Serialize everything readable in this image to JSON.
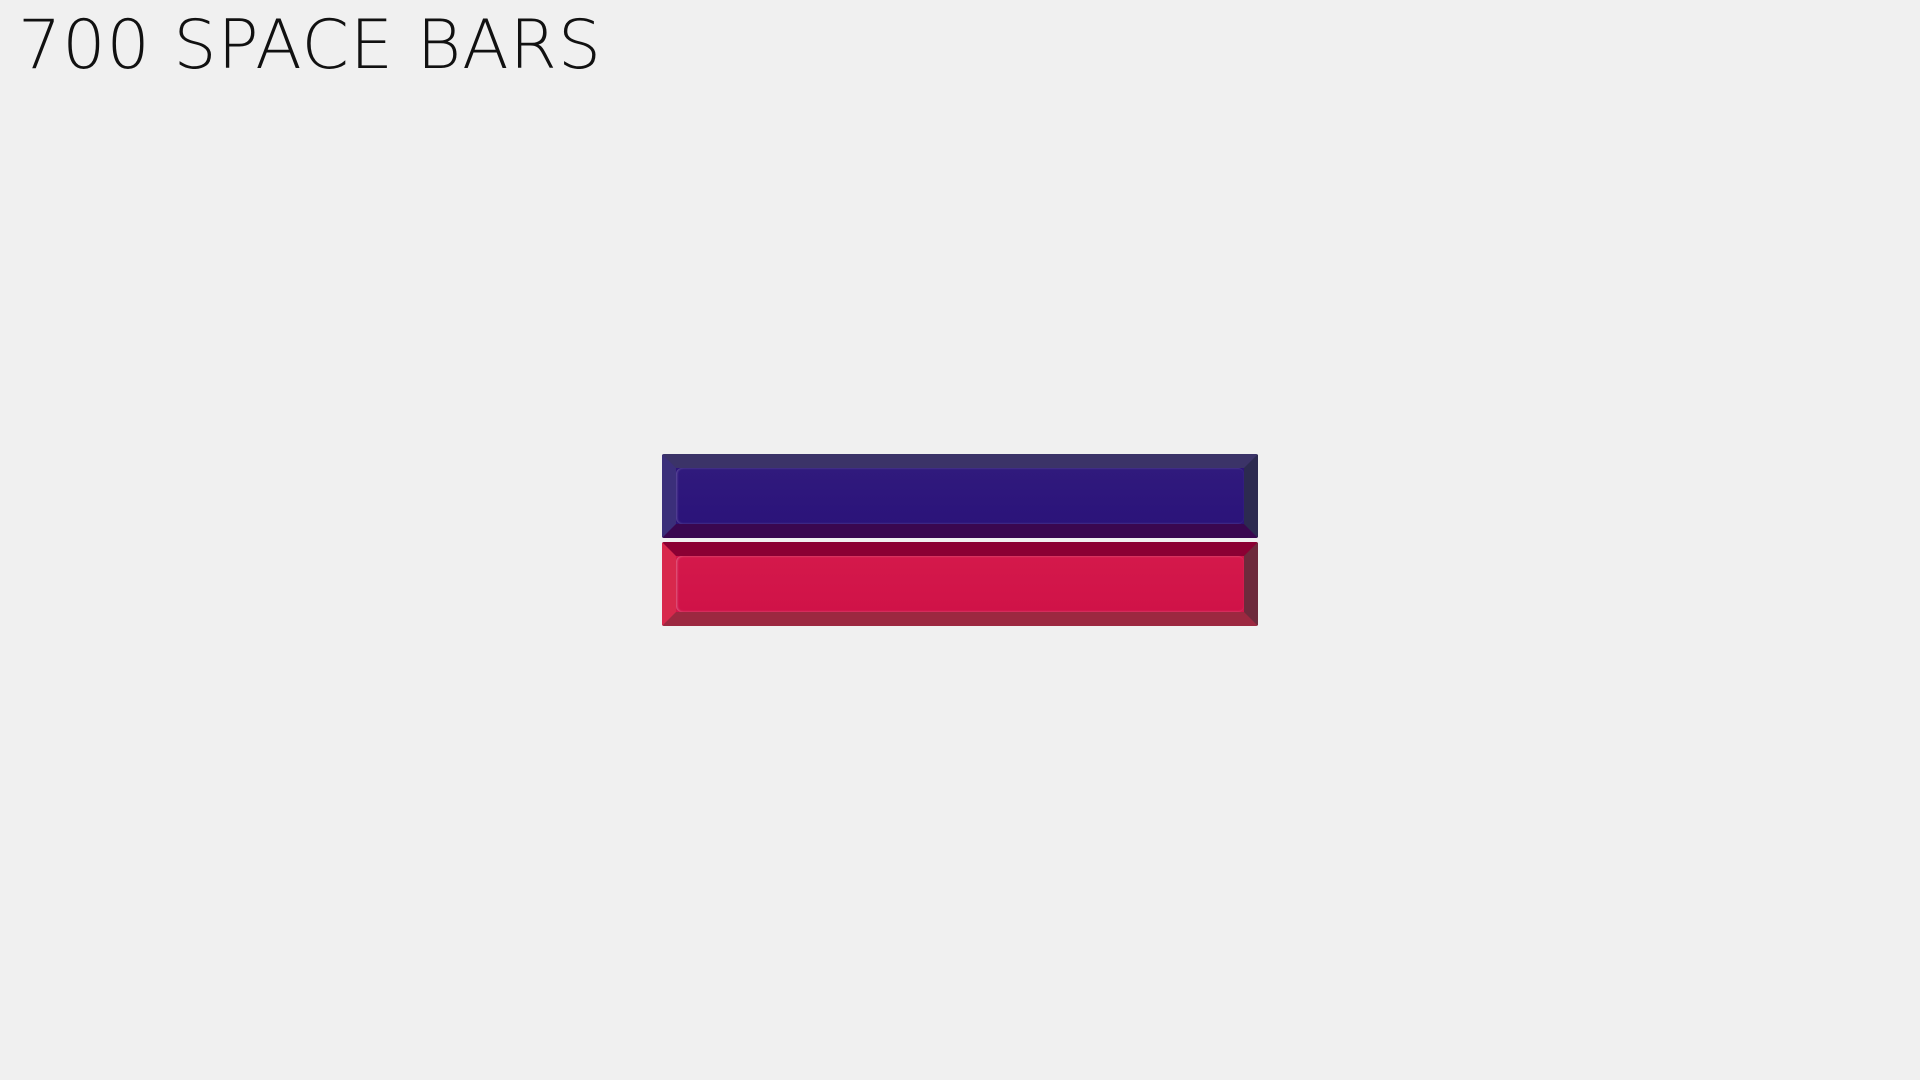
{
  "header": {
    "title": "700 SPACE BARS"
  },
  "keys": [
    {
      "name": "blue",
      "color": "#2d1479"
    },
    {
      "name": "red",
      "color": "#d2164a"
    }
  ]
}
